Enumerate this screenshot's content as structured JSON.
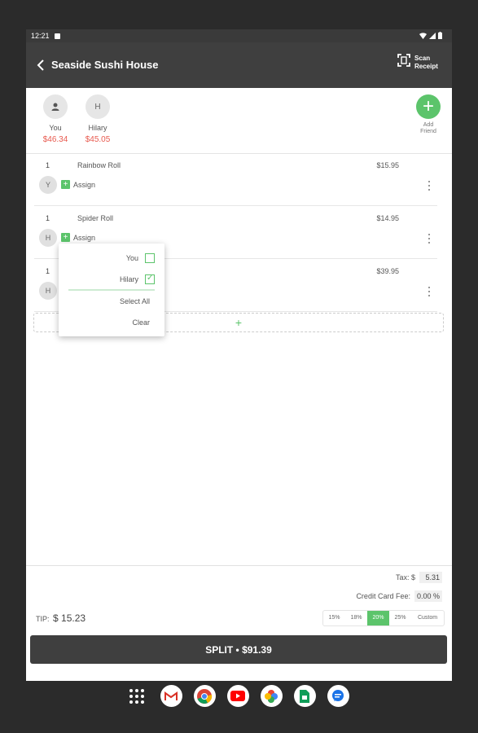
{
  "status_bar": {
    "time": "12:21"
  },
  "app_bar": {
    "title": "Seaside Sushi House",
    "scan_label": "Scan Receipt"
  },
  "friends": [
    {
      "initial": "",
      "name": "You",
      "amount": "$46.34"
    },
    {
      "initial": "H",
      "name": "Hilary",
      "amount": "$45.05"
    }
  ],
  "add_friend_label": "Add Friend",
  "items": [
    {
      "qty": "1",
      "name": "Rainbow Roll",
      "price": "$15.95",
      "chip": "Y",
      "assign_label": "Assign"
    },
    {
      "qty": "1",
      "name": "Spider Roll",
      "price": "$14.95",
      "chip": "H",
      "assign_label": "Assign"
    },
    {
      "qty": "1",
      "name": "",
      "price": "$39.95",
      "chip": "H",
      "assign_label": ""
    }
  ],
  "add_item_symbol": "+",
  "assign_popup": {
    "options": [
      {
        "label": "You",
        "checked": false
      },
      {
        "label": "Hilary",
        "checked": true
      }
    ],
    "select_all": "Select All",
    "clear": "Clear"
  },
  "totals": {
    "tax_label": "Tax: $",
    "tax_value": "5.31",
    "cc_fee_label": "Credit Card Fee:",
    "cc_fee_value": "0.00 %",
    "tip_label": "TIP:",
    "tip_value": "$ 15.23",
    "tip_options": [
      "15%",
      "18%",
      "20%",
      "25%",
      "Custom"
    ],
    "tip_selected": "20%"
  },
  "split_button": "SPLIT • $91.39",
  "dock_apps": [
    "apps-grid",
    "gmail",
    "chrome",
    "youtube",
    "photos",
    "sheets",
    "messages"
  ],
  "colors": {
    "accent": "#5cc46b",
    "amount": "#e85a4f",
    "appbar": "#3f3f3f"
  }
}
